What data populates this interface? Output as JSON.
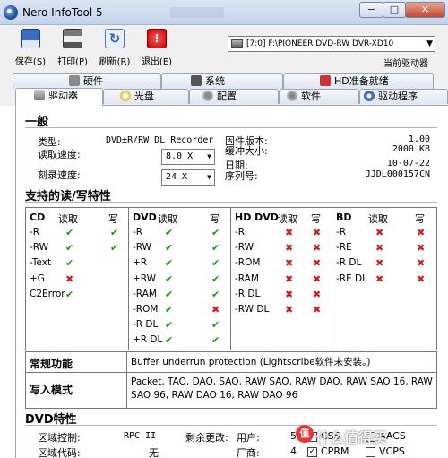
{
  "window": {
    "title": "Nero InfoTool 5",
    "min": "−",
    "max": "□",
    "close": "✕"
  },
  "toolbar": {
    "save": "保存(S)",
    "print": "打印(P)",
    "refresh": "刷新(R)",
    "exit": "退出(E)",
    "drive": "[7:0] F:\\PIONEER DVD-RW DVR-XD10",
    "drive_caption": "当前驱动器"
  },
  "tabs_row1": [
    "硬件",
    "系统",
    "HD准备就绪"
  ],
  "tabs_row2": [
    "驱动器",
    "光盘",
    "配置",
    "软件",
    "驱动程序"
  ],
  "general": {
    "heading": "一般",
    "type_label": "类型:",
    "type_value": "DVD±R/RW DL Recorder",
    "read_label": "读取速度:",
    "read_value": "8.0 X",
    "write_label": "刻录速度:",
    "write_value": "24 X",
    "fw_label": "固件版本:",
    "fw_value": "1.00",
    "buf_label": "缓冲大小:",
    "buf_value": "2000 KB",
    "date_label": "日期:",
    "date_value": "10-07-22",
    "sn_label": "序列号:",
    "sn_value": "JJDL000157CN"
  },
  "caps": {
    "heading": "支持的读/写特性",
    "read": "读取",
    "write": "写",
    "cd": {
      "title": "CD",
      "rows": [
        {
          "name": "-R",
          "r": "ok",
          "w": "ok"
        },
        {
          "name": "-RW",
          "r": "ok",
          "w": "ok"
        },
        {
          "name": "-Text",
          "r": "ok",
          "w": ""
        },
        {
          "name": "+G",
          "r": "no",
          "w": ""
        },
        {
          "name": "C2Error",
          "r": "ok",
          "w": ""
        }
      ]
    },
    "dvd": {
      "title": "DVD",
      "rows": [
        {
          "name": "-R",
          "r": "ok",
          "w": "ok"
        },
        {
          "name": "-RW",
          "r": "ok",
          "w": "ok"
        },
        {
          "name": "+R",
          "r": "ok",
          "w": "ok"
        },
        {
          "name": "+RW",
          "r": "ok",
          "w": "ok"
        },
        {
          "name": "-RAM",
          "r": "ok",
          "w": "ok"
        },
        {
          "name": "-ROM",
          "r": "ok",
          "w": "no"
        },
        {
          "name": "-R DL",
          "r": "ok",
          "w": "ok"
        },
        {
          "name": "+R DL",
          "r": "ok",
          "w": "ok"
        }
      ]
    },
    "hddvd": {
      "title": "HD DVD",
      "rows": [
        {
          "name": "-R",
          "r": "no",
          "w": "no"
        },
        {
          "name": "-RW",
          "r": "no",
          "w": "no"
        },
        {
          "name": "-ROM",
          "r": "no",
          "w": "no"
        },
        {
          "name": "-RAM",
          "r": "no",
          "w": "no"
        },
        {
          "name": "-R DL",
          "r": "no",
          "w": "no"
        },
        {
          "name": "-RW DL",
          "r": "no",
          "w": "no"
        }
      ]
    },
    "bd": {
      "title": "BD",
      "rows": [
        {
          "name": "-R",
          "r": "no",
          "w": "no"
        },
        {
          "name": "-RE",
          "r": "no",
          "w": "no"
        },
        {
          "name": "-R DL",
          "r": "no",
          "w": "no"
        },
        {
          "name": "-RE DL",
          "r": "no",
          "w": "no"
        }
      ]
    }
  },
  "features": {
    "general_label": "常规功能",
    "general_value": "Buffer underrun protection (Lightscribe软件未安装。)",
    "write_label": "写入模式",
    "write_value": "Packet, TAO, DAO, SAO, RAW SAO, RAW DAO, RAW SAO 16, RAW SAO 96, RAW DAO 16, RAW DAO 96"
  },
  "dvd_features": {
    "heading": "DVD特性",
    "region_ctrl_label": "区域控制:",
    "region_ctrl_value": "RPC II",
    "remaining_label": "剩余更改:",
    "user_label": "用户:",
    "user_value": "5",
    "region_code_label": "区域代码:",
    "region_code_value": "无",
    "vendor_label": "厂商:",
    "vendor_value": "4",
    "css": "CSS",
    "aacs": "AACS",
    "cprm": "CPRM",
    "vcps": "VCPS"
  },
  "watermark": "什么值得买"
}
